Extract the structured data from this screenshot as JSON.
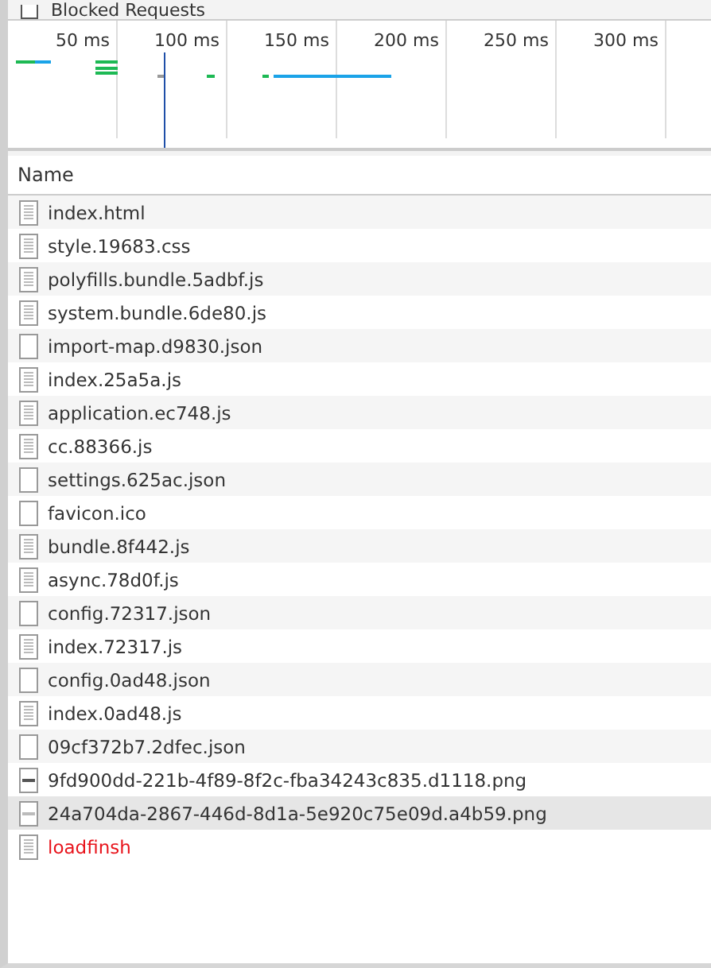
{
  "filter": {
    "label": "Blocked Requests",
    "checked": false
  },
  "timeline": {
    "ticks": [
      "50 ms",
      "100 ms",
      "150 ms",
      "200 ms",
      "250 ms",
      "300 ms"
    ]
  },
  "table": {
    "columns": [
      "Name"
    ],
    "rows": [
      {
        "name": "index.html",
        "kind": "doc",
        "selected": false,
        "failed": false
      },
      {
        "name": "style.19683.css",
        "kind": "doc",
        "selected": false,
        "failed": false
      },
      {
        "name": "polyfills.bundle.5adbf.js",
        "kind": "doc",
        "selected": false,
        "failed": false
      },
      {
        "name": "system.bundle.6de80.js",
        "kind": "doc",
        "selected": false,
        "failed": false
      },
      {
        "name": "import-map.d9830.json",
        "kind": "blank",
        "selected": false,
        "failed": false
      },
      {
        "name": "index.25a5a.js",
        "kind": "doc",
        "selected": false,
        "failed": false
      },
      {
        "name": "application.ec748.js",
        "kind": "doc",
        "selected": false,
        "failed": false
      },
      {
        "name": "cc.88366.js",
        "kind": "doc",
        "selected": false,
        "failed": false
      },
      {
        "name": "settings.625ac.json",
        "kind": "blank",
        "selected": false,
        "failed": false
      },
      {
        "name": "favicon.ico",
        "kind": "blank",
        "selected": false,
        "failed": false
      },
      {
        "name": "bundle.8f442.js",
        "kind": "doc",
        "selected": false,
        "failed": false
      },
      {
        "name": "async.78d0f.js",
        "kind": "doc",
        "selected": false,
        "failed": false
      },
      {
        "name": "config.72317.json",
        "kind": "blank",
        "selected": false,
        "failed": false
      },
      {
        "name": "index.72317.js",
        "kind": "doc",
        "selected": false,
        "failed": false
      },
      {
        "name": "config.0ad48.json",
        "kind": "blank",
        "selected": false,
        "failed": false
      },
      {
        "name": "index.0ad48.js",
        "kind": "doc",
        "selected": false,
        "failed": false
      },
      {
        "name": "09cf372b7.2dfec.json",
        "kind": "blank",
        "selected": false,
        "failed": false
      },
      {
        "name": "9fd900dd-221b-4f89-8f2c-fba34243c835.d1118.png",
        "kind": "image",
        "selected": false,
        "failed": false
      },
      {
        "name": "24a704da-2867-446d-8d1a-5e920c75e09d.a4b59.png",
        "kind": "image",
        "selected": true,
        "failed": false
      },
      {
        "name": "loadfinsh",
        "kind": "doc",
        "selected": false,
        "failed": true
      }
    ]
  }
}
